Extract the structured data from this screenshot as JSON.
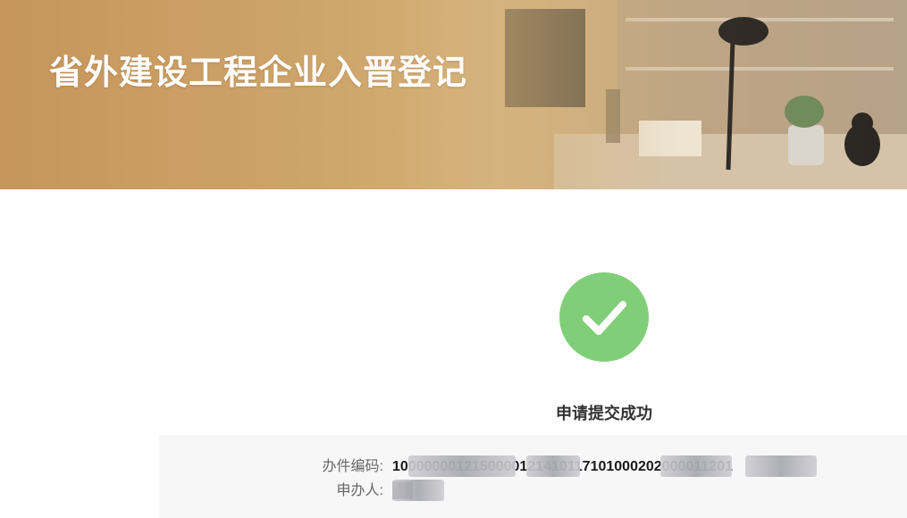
{
  "banner": {
    "title": "省外建设工程企业入晋登记"
  },
  "result": {
    "icon": "check-icon",
    "icon_color": "#80cf78",
    "message": "申请提交成功"
  },
  "details": {
    "case_no_label": "办件编码:",
    "case_no_value": "1000000012150000121410117101000202000011201",
    "applicant_label": "申办人:",
    "applicant_value": "██"
  }
}
